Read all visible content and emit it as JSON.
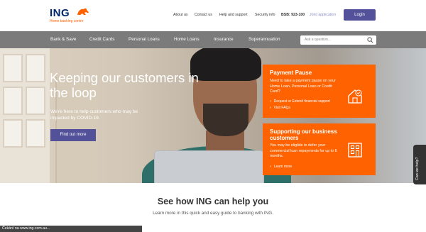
{
  "header": {
    "logo_text": "ING",
    "tagline": "Home banking centre",
    "links": [
      "About us",
      "Contact us",
      "Help and support",
      "Security info"
    ],
    "bsb": "BSB: 923-100",
    "joint_application": "Joint application",
    "login": "Login"
  },
  "nav": {
    "items": [
      "Bank & Save",
      "Credit Cards",
      "Personal Loans",
      "Home Loans",
      "Insurance",
      "Superannuation"
    ],
    "search_placeholder": "Ask a question..."
  },
  "hero": {
    "title": "Keeping our customers in the loop",
    "subtitle": "We're here to help customers who may be impacted by COVID-19.",
    "cta": "Find out more"
  },
  "cards": [
    {
      "title": "Payment Pause",
      "text": "Need to take a payment pause on your Home Loan, Personal Loan or Credit Card?",
      "links": [
        "Request or Extend financial support",
        "Visit FAQs"
      ],
      "icon": "house-check-icon"
    },
    {
      "title": "Supporting our business customers",
      "text": "You may be eligible to defer your commercial loan repayments for up to 6 months.",
      "links": [
        "Learn more"
      ],
      "icon": "building-icon"
    }
  ],
  "side_tab": "Can we help?",
  "section": {
    "title": "See how ING can help you",
    "subtitle": "Learn more in this quick and easy guide to banking with ING."
  },
  "status_bar": "Čekání na www.ing.com.au...",
  "colors": {
    "brand_orange": "#ff6200",
    "brand_navy": "#00286a",
    "button_purple": "#525199",
    "nav_gray": "#7b7b7b"
  }
}
